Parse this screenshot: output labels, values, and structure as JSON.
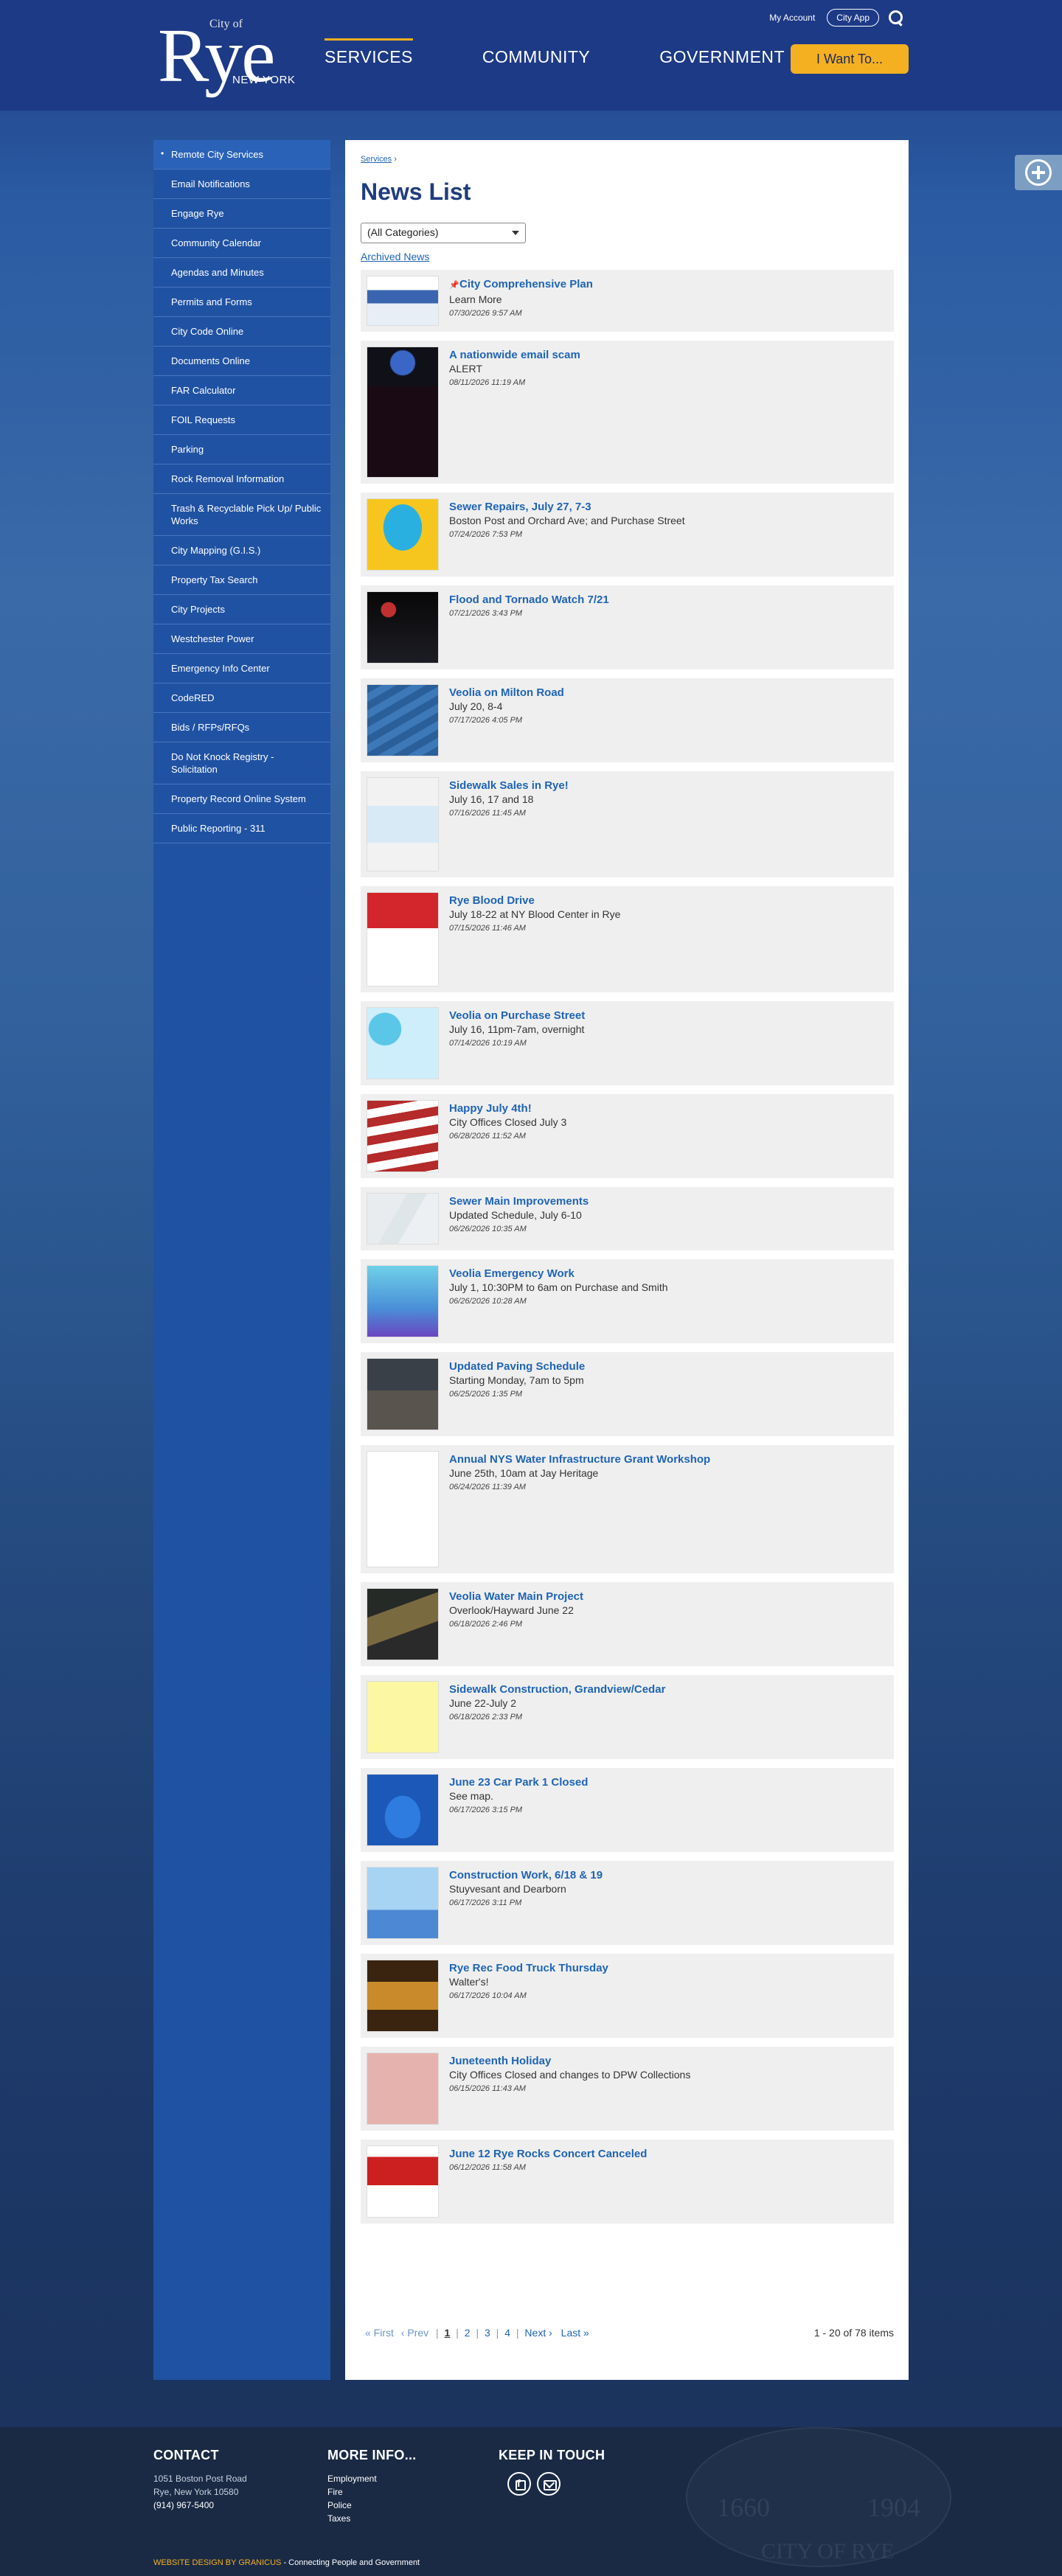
{
  "header": {
    "logo_city": "City of",
    "logo_rye": "Rye",
    "logo_ny": "NEW YORK",
    "nav": [
      "SERVICES",
      "COMMUNITY",
      "GOVERNMENT"
    ],
    "my_account": "My Account",
    "city_app": "City App",
    "i_want": "I Want To..."
  },
  "sidebar": {
    "items": [
      "Remote City Services",
      "Email Notifications",
      "Engage Rye",
      "Community Calendar",
      "Agendas and Minutes",
      "Permits and Forms",
      "City Code Online",
      "Documents Online",
      "FAR Calculator",
      "FOIL Requests",
      "Parking",
      "Rock Removal Information",
      "Trash & Recyclable Pick Up/ Public Works",
      "City Mapping (G.I.S.)",
      "Property Tax Search",
      "City Projects",
      "Westchester Power",
      "Emergency Info Center",
      "CodeRED",
      "Bids / RFPs/RFQs",
      "Do Not Knock Registry - Solicitation",
      "Property Record Online System",
      "Public Reporting - 311"
    ]
  },
  "main": {
    "breadcrumb": "Services",
    "breadcrumb_sep": "›",
    "title": "News List",
    "category_select": "(All Categories)",
    "archived": "Archived News",
    "news": [
      {
        "title": "City Comprehensive Plan",
        "desc": "Learn More",
        "date": "07/30/2026 9:57 AM",
        "pinned": true,
        "thumb": "plan"
      },
      {
        "title": "A nationwide email scam",
        "desc": "ALERT",
        "date": "08/11/2026 11:19 AM",
        "thumb": "scam"
      },
      {
        "title": "Sewer Repairs, July 27, 7-3",
        "desc": "Boston Post and Orchard Ave; and Purchase Street",
        "date": "07/24/2026 7:53 PM",
        "thumb": "important"
      },
      {
        "title": "Flood and Tornado Watch 7/21",
        "desc": "",
        "date": "07/21/2026 3:43 PM",
        "thumb": "flood"
      },
      {
        "title": "Veolia on Milton Road",
        "desc": "July 20, 8-4",
        "date": "07/17/2026 4:05 PM",
        "thumb": "veolia-water"
      },
      {
        "title": "Sidewalk Sales in Rye!",
        "desc": "July 16, 17 and 18",
        "date": "07/16/2026 11:45 AM",
        "thumb": "sidewalk-sale"
      },
      {
        "title": "Rye Blood Drive",
        "desc": "July 18-22 at NY Blood Center in Rye",
        "date": "07/15/2026 11:46 AM",
        "thumb": "blood"
      },
      {
        "title": "Veolia on Purchase Street",
        "desc": "July 16, 11pm-7am, overnight",
        "date": "07/14/2026 10:19 AM",
        "thumb": "purchase"
      },
      {
        "title": "Happy July 4th!",
        "desc": "City Offices Closed July 3",
        "date": "06/28/2026 11:52 AM",
        "thumb": "july4"
      },
      {
        "title": "Sewer Main Improvements",
        "desc": "Updated Schedule, July 6-10",
        "date": "06/26/2026 10:35 AM",
        "thumb": "map"
      },
      {
        "title": "Veolia Emergency Work",
        "desc": "July 1, 10:30PM to 6am on Purchase and Smith",
        "date": "06/26/2026 10:28 AM",
        "thumb": "veolia-work"
      },
      {
        "title": "Updated Paving Schedule",
        "desc": "Starting Monday, 7am to 5pm",
        "date": "06/25/2026 1:35 PM",
        "thumb": "paving"
      },
      {
        "title": "Annual NYS Water Infrastructure Grant Workshop",
        "desc": "June 25th, 10am at Jay Heritage",
        "date": "06/24/2026 11:39 AM",
        "thumb": "flyer"
      },
      {
        "title": "Veolia Water Main Project",
        "desc": "Overlook/Hayward June 22",
        "date": "06/18/2026 2:46 PM",
        "thumb": "watermain"
      },
      {
        "title": "Sidewalk Construction, Grandview/Cedar",
        "desc": "June 22-July 2",
        "date": "06/18/2026 2:33 PM",
        "thumb": "yellow-note"
      },
      {
        "title": "June 23 Car Park 1 Closed",
        "desc": "See map.",
        "date": "06/17/2026 3:15 PM",
        "thumb": "closed"
      },
      {
        "title": "Construction Work, 6/18 & 19",
        "desc": "Stuyvesant and Dearborn",
        "date": "06/17/2026 3:11 PM",
        "thumb": "construction"
      },
      {
        "title": "Rye Rec Food Truck Thursday",
        "desc": "Walter's!",
        "date": "06/17/2026 10:04 AM",
        "thumb": "foodtruck"
      },
      {
        "title": "Juneteenth Holiday",
        "desc": "City Offices Closed and changes to DPW Collections",
        "date": "06/15/2026 11:43 AM",
        "thumb": "juneteenth"
      },
      {
        "title": "June 12 Rye Rocks Concert Canceled",
        "desc": "",
        "date": "06/12/2026 11:58 AM",
        "thumb": "ryerocks"
      }
    ],
    "pager": {
      "first": "« First",
      "prev": "‹ Prev",
      "pages": [
        "1",
        "2",
        "3",
        "4"
      ],
      "next": "Next ›",
      "last": "Last »",
      "count": "1 - 20 of 78 items"
    }
  },
  "footer": {
    "contact_title": "CONTACT",
    "address1": "1051 Boston Post Road",
    "address2": "Rye, New York 10580",
    "phone": "(914) 967-5400",
    "more_title": "MORE INFO...",
    "more_links": [
      "Employment",
      "Fire",
      "Police",
      "Taxes"
    ],
    "keep_title": "KEEP IN TOUCH",
    "seal_year1": "1660",
    "seal_year2": "1904",
    "seal_text": "CITY OF RYE",
    "credit_link": "WEBSITE DESIGN BY GRANICUS",
    "credit_text": " - Connecting People and Government"
  }
}
